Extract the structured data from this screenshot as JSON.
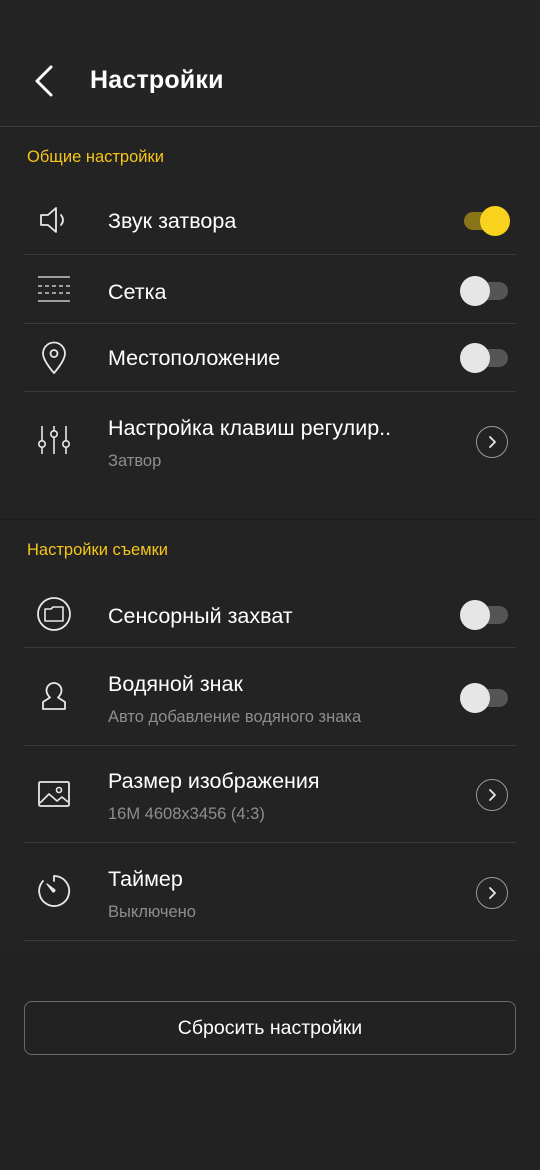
{
  "header": {
    "title": "Настройки",
    "back_icon": "chevron-left-icon"
  },
  "general": {
    "title": "Общие настройки",
    "items": [
      {
        "label": "Звук затвора",
        "icon": "speaker-icon",
        "control": "toggle",
        "on": true
      },
      {
        "label": "Сетка",
        "icon": "grid-icon",
        "control": "toggle",
        "on": false
      },
      {
        "label": "Местоположение",
        "icon": "location-pin-icon",
        "control": "toggle",
        "on": false
      },
      {
        "label": "Настройка клавиш регулир..",
        "sublabel": "Затвор",
        "icon": "sliders-icon",
        "control": "chevron"
      }
    ]
  },
  "shooting": {
    "title": "Настройки съемки",
    "items": [
      {
        "label": "Сенсорный захват",
        "icon": "touch-capture-icon",
        "control": "toggle",
        "on": false
      },
      {
        "label": "Водяной знак",
        "sublabel": "Авто добавление водяного знака",
        "icon": "watermark-person-icon",
        "control": "toggle",
        "on": false
      },
      {
        "label": "Размер изображения",
        "sublabel": "16M 4608x3456 (4:3)",
        "icon": "image-icon",
        "control": "chevron"
      },
      {
        "label": "Таймер",
        "sublabel": "Выключено",
        "icon": "timer-icon",
        "control": "chevron"
      }
    ]
  },
  "reset": {
    "label": "Сбросить настройки"
  },
  "colors": {
    "accent": "#f5c518",
    "background": "#222222",
    "toggle_on": "#f8d21c"
  }
}
